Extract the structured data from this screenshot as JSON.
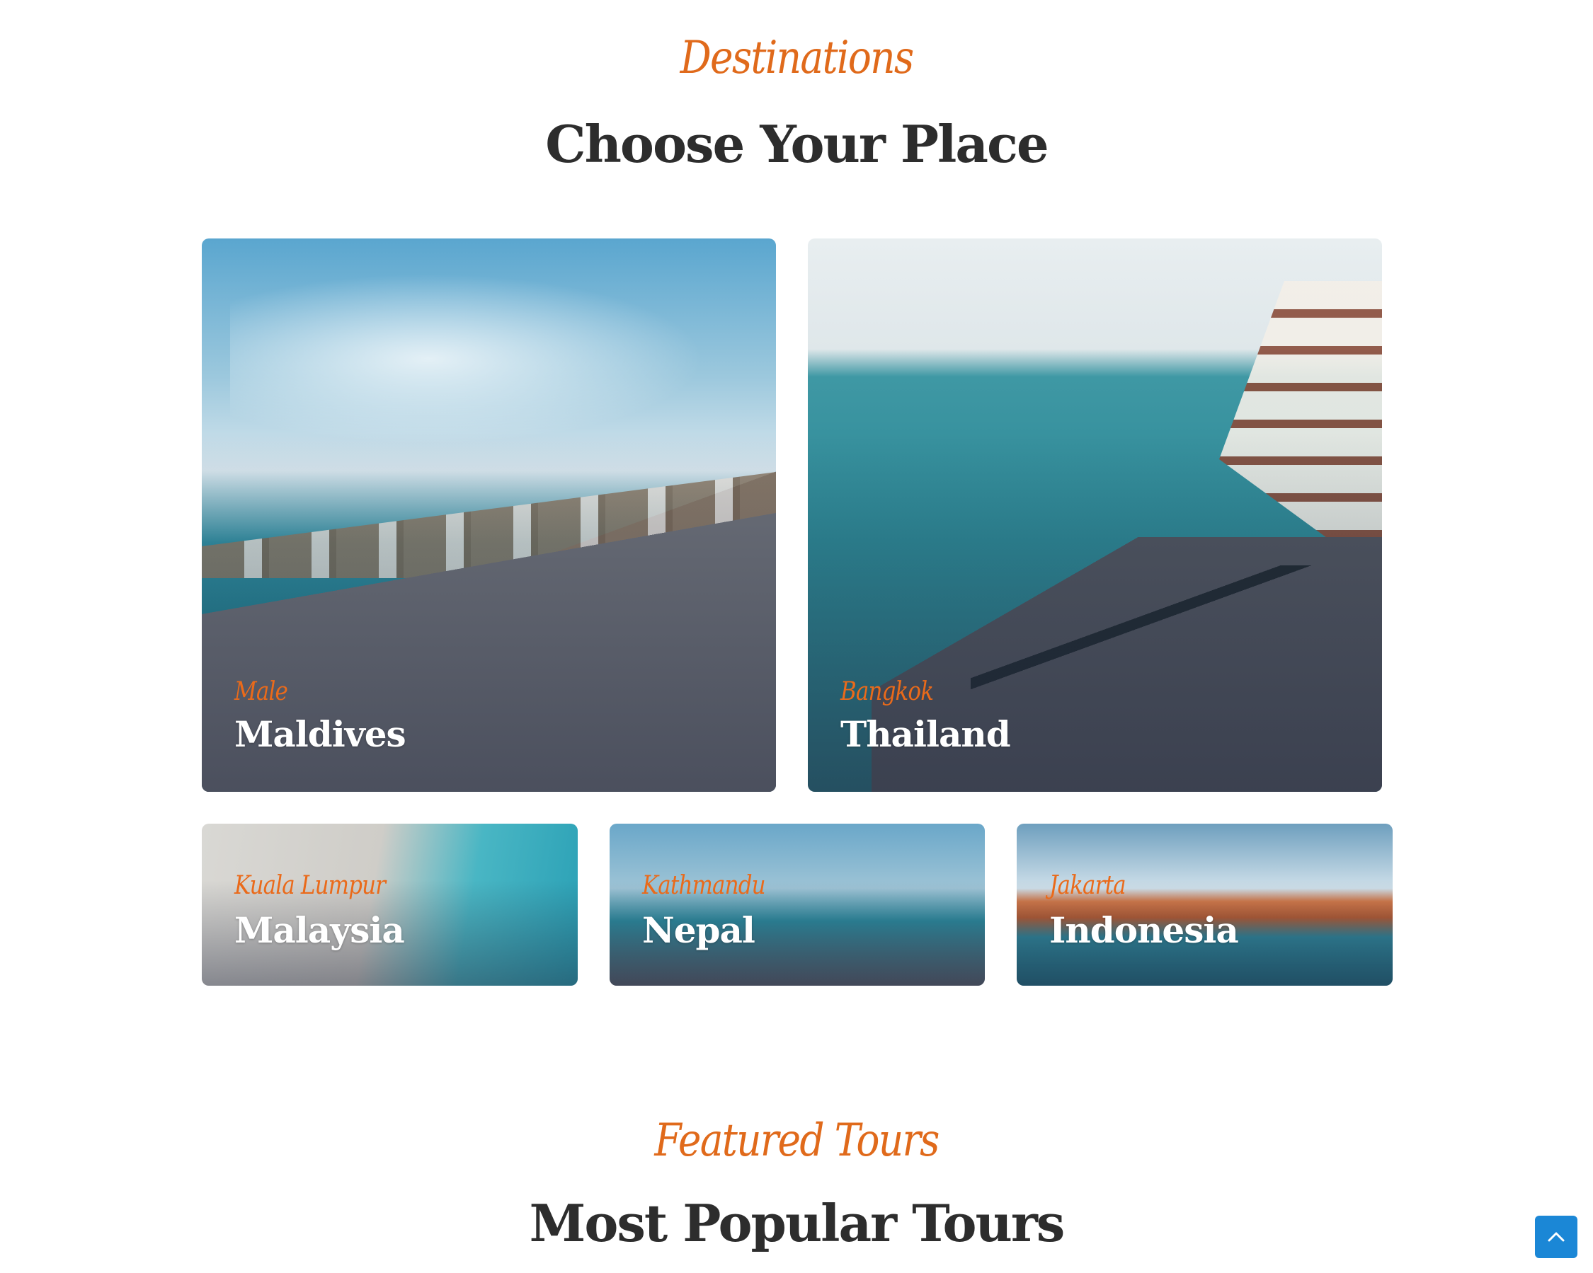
{
  "destinations_section": {
    "kicker": "Destinations",
    "title": "Choose Your Place"
  },
  "destination_cards": [
    {
      "city": "Male",
      "country": "Maldives"
    },
    {
      "city": "Bangkok",
      "country": "Thailand"
    },
    {
      "city": "Kuala Lumpur",
      "country": "Malaysia"
    },
    {
      "city": "Kathmandu",
      "country": "Nepal"
    },
    {
      "city": "Jakarta",
      "country": "Indonesia"
    }
  ],
  "tours_section": {
    "kicker": "Featured Tours",
    "title": "Most Popular Tours"
  },
  "back_to_top": {
    "icon": "chevron-up-icon"
  },
  "colors": {
    "accent": "#e06a1b",
    "heading": "#2d2d2d",
    "card_title": "#ffffff",
    "back_to_top_bg": "#1b87d6"
  }
}
